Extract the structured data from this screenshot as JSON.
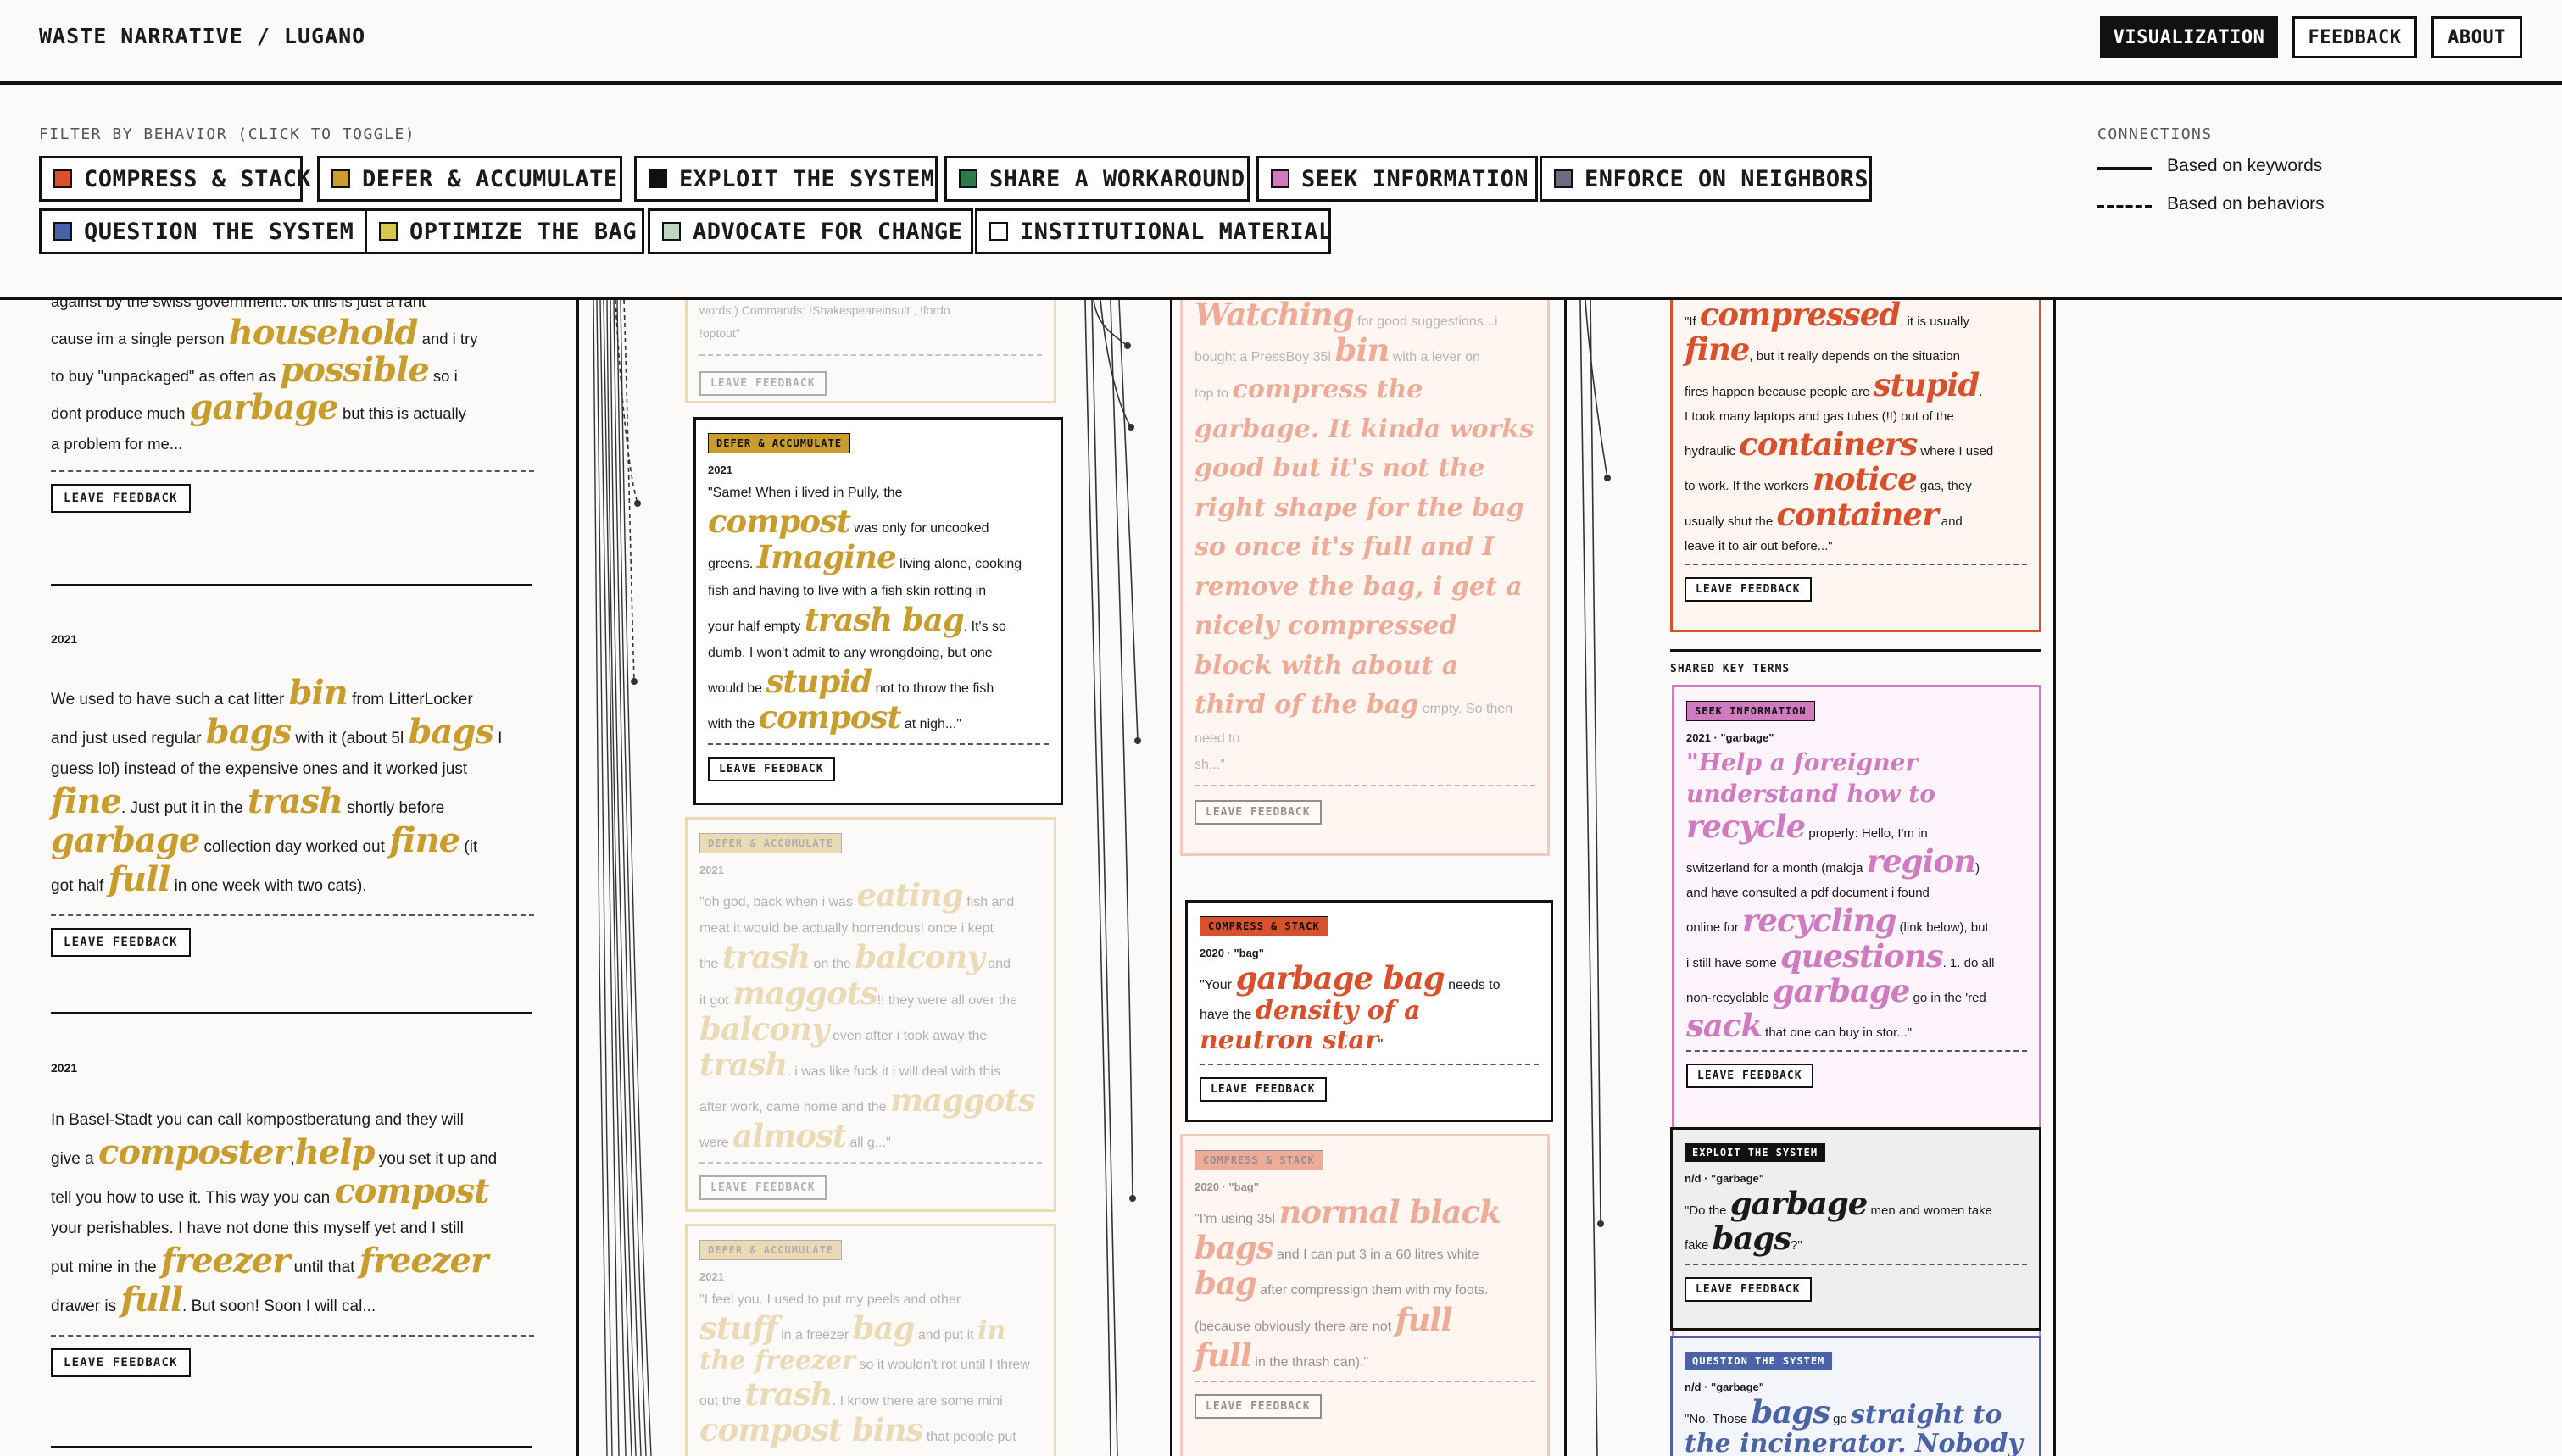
{
  "header": {
    "title": "WASTE NARRATIVE / LUGANO",
    "nav": {
      "visualization": "VISUALIZATION",
      "feedback": "FEEDBACK",
      "about": "ABOUT"
    }
  },
  "filters": {
    "label": "FILTER BY BEHAVIOR (CLICK TO TOGGLE)",
    "items": [
      {
        "label": "COMPRESS & STACK",
        "color": "#d9512c"
      },
      {
        "label": "DEFER & ACCUMULATE",
        "color": "#c99d2d"
      },
      {
        "label": "EXPLOIT THE SYSTEM",
        "color": "#111111"
      },
      {
        "label": "SHARE A WORKAROUND",
        "color": "#2e7a4a"
      },
      {
        "label": "SEEK INFORMATION",
        "color": "#d07bc0"
      },
      {
        "label": "ENFORCE ON NEIGHBORS",
        "color": "#6b6b83"
      },
      {
        "label": "QUESTION THE SYSTEM",
        "color": "#4a63a8"
      },
      {
        "label": "OPTIMIZE THE BAG",
        "color": "#d6c84a"
      },
      {
        "label": "ADVOCATE FOR CHANGE",
        "color": "#bfd6c2"
      },
      {
        "label": "INSTITUTIONAL MATERIAL",
        "color": "#ffffff"
      }
    ]
  },
  "connections": {
    "title": "CONNECTIONS",
    "keywords": "Based on keywords",
    "behaviors": "Based on behaviors"
  },
  "left_entries": {
    "e1": {
      "t1": "against by the swiss government!: ok this is just a rant",
      "t2": "cause im a single person",
      "k1": "household",
      "t3": "and i try",
      "t4": "to buy \"unpackaged\" as often as",
      "k2": "possible",
      "t5": "so i",
      "t6": "dont produce much",
      "k3": "garbage",
      "t7": "but this is actually",
      "t8": "a problem for me...",
      "leave": "LEAVE FEEDBACK"
    },
    "e2": {
      "year": "2021",
      "t1": "We used to have such a cat litter",
      "k1": "bin",
      "t2": "from LitterLocker",
      "t3": "and just used regular",
      "k2": "bags",
      "t4": "with it (about 5l",
      "k3": "bags",
      "t5": "I",
      "t6": "guess lol) instead of the expensive ones and it worked just",
      "k4": "fine",
      "t7": ". Just put it in the",
      "k5": "trash",
      "t8": "shortly before",
      "k6": "garbage",
      "t9": "collection day worked out",
      "k7": "fine",
      "t10": "(it",
      "t11": "got half",
      "k8": "full",
      "t12": "in one week with two cats).",
      "leave": "LEAVE FEEDBACK"
    },
    "e3": {
      "year": "2021",
      "t1": "In Basel-Stadt you can call kompostberatung and they will",
      "t2": "give a",
      "k1": "composter",
      "t3": ",",
      "k2": "help",
      "t4": "you set it up and",
      "t5": "tell you how to use it. This way you can",
      "k3": "compost",
      "t6": "your perishables. I have not done this myself yet and I still",
      "t7": "put mine in the",
      "k4": "freezer",
      "t8": "until that",
      "k5": "freezer",
      "t9": "drawer is",
      "k6": "full",
      "t10": ". But soon! Soon I will cal...",
      "leave": "LEAVE FEEDBACK"
    }
  },
  "col2": {
    "top": {
      "t1": "words.) Commands: !Shakespeareinsult , !fordo ,",
      "t2": "!optout\"",
      "leave": "LEAVE FEEDBACK"
    },
    "c1": {
      "badge": "DEFER & ACCUMULATE",
      "year": "2021",
      "t1": "\"Same! When i lived in Pully, the",
      "k1": "compost",
      "t2": "was only for uncooked",
      "t3": "greens.",
      "k2": "Imagine",
      "t4": "living alone, cooking",
      "t5": "fish and having to live with a fish skin rotting in",
      "t6": "your half empty",
      "k3": "trash bag",
      "t7": ". It's so",
      "t8": "dumb. I won't admit to any wrongdoing, but one",
      "t9": "would be",
      "k4": "stupid",
      "t10": "not to throw the fish",
      "t11": "with the",
      "k5": "compost",
      "t12": "at nigh...\"",
      "leave": "LEAVE FEEDBACK"
    },
    "c2": {
      "badge": "DEFER & ACCUMULATE",
      "year": "2021",
      "t1": "\"oh god, back when i was",
      "k1": "eating",
      "t2": "fish and",
      "t3": "meat it would be actually horrendous! once i kept",
      "t4": "the",
      "k2": "trash",
      "t5": "on the",
      "k3": "balcony",
      "t6": "and",
      "t7": "it got",
      "k4": "maggots",
      "t8": "!! they were all over the",
      "k5": "balcony",
      "t9": "even after i took away the",
      "k6": "trash",
      "t10": ". i was like fuck it i will deal with this",
      "t11": "after work, came home and the",
      "k7": "maggots",
      "t12": "were",
      "k8": "almost",
      "t13": "all g...\"",
      "leave": "LEAVE FEEDBACK"
    },
    "c3": {
      "badge": "DEFER & ACCUMULATE",
      "year": "2021",
      "t1": "\"I feel you. I used to put my peels and other",
      "k1": "stuff",
      "t2": "in a freezer",
      "k2": "bag",
      "t3": "and put it",
      "k3": "in the freezer",
      "t4": "so it wouldn't rot until I threw",
      "t5": "out the",
      "k4": "trash",
      "t6": ". I know there are some mini",
      "k5": "compost bins",
      "t7": "that people put"
    }
  },
  "col3": {
    "c1": {
      "k1": "Watching",
      "t1": "for good suggestions...i",
      "t2": "bought a PressBoy 35l",
      "k2": "bin",
      "t3": "with a lever on",
      "t4": "top to",
      "k3": "compress the garbage. It kinda works good but it's not the right shape for the bag so once it's full and I remove the bag, i get a nicely compressed block with about a third of the bag",
      "t5": "empty. So then need to",
      "t6": "sh...\"",
      "leave": "LEAVE FEEDBACK"
    },
    "c2": {
      "badge": "COMPRESS & STACK",
      "meta": "2020 · \"bag\"",
      "t1": "\"Your",
      "k1": "garbage bag",
      "t2": "needs to",
      "t3": "have the",
      "k2": "density of a neutron star",
      "t4": "\"",
      "leave": "LEAVE FEEDBACK"
    },
    "c3": {
      "badge": "COMPRESS & STACK",
      "meta": "2020 · \"bag\"",
      "t1": "\"I'm using 35l",
      "k1": "normal black",
      "k2": "bags",
      "t2": "and I can put 3 in a 60 litres white",
      "k3": "bag",
      "t3": "after compressign them with my foots.",
      "t4": "(because obviously there are not",
      "k4": "full",
      "k5": "full",
      "t5": "in the thrash can).\"",
      "leave": "LEAVE FEEDBACK"
    }
  },
  "col4": {
    "c1": {
      "t1": "\"If",
      "k1": "compressed",
      "t2": ", it is usually",
      "k2": "fine",
      "t3": ", but it really depends on the situation",
      "t4": "fires happen because people are",
      "k3": "stupid",
      "t5": ".",
      "t6": "I took many laptops and gas tubes (!!) out of the",
      "t7": "hydraulic",
      "k4": "containers",
      "t8": "where I used",
      "t9": "to work. If the workers",
      "k5": "notice",
      "t10": "gas, they",
      "t11": "usually shut the",
      "k6": "container",
      "t12": "and",
      "t13": "leave it to air out before...\"",
      "leave": "LEAVE FEEDBACK"
    },
    "shared_title": "SHARED KEY TERMS",
    "c2": {
      "badge": "SEEK INFORMATION",
      "meta": "2021 · \"garbage\"",
      "k1": "\"Help a foreigner understand how to",
      "k2": "recycle",
      "t1": "properly: Hello, I'm in",
      "t2": "switzerland for a month (maloja",
      "k3": "region",
      "t3": ")",
      "t4": "and have consulted a pdf document i found",
      "t5": "online for",
      "k4": "recycling",
      "t6": "(link below), but",
      "t7": "i still have some",
      "k5": "questions",
      "t8": ". 1. do all",
      "t9": "non-recyclable",
      "k6": "garbage",
      "t10": "go in the 'red",
      "k7": "sack",
      "t11": "that one can buy in stor...\"",
      "leave": "LEAVE FEEDBACK"
    },
    "c3": {
      "badge": "EXPLOIT THE SYSTEM",
      "meta": "n/d · \"garbage\"",
      "t1": "\"Do the",
      "k1": "garbage",
      "t2": "men and women take",
      "t3": "fake",
      "k2": "bags",
      "t4": "?\"",
      "leave": "LEAVE FEEDBACK"
    },
    "c4": {
      "badge": "QUESTION THE SYSTEM",
      "meta": "n/d · \"garbage\"",
      "t1": "\"No. Those",
      "k1": "bags",
      "t2": "go",
      "k2": "straight to",
      "k3": "the incinerator. Nobody is"
    }
  }
}
